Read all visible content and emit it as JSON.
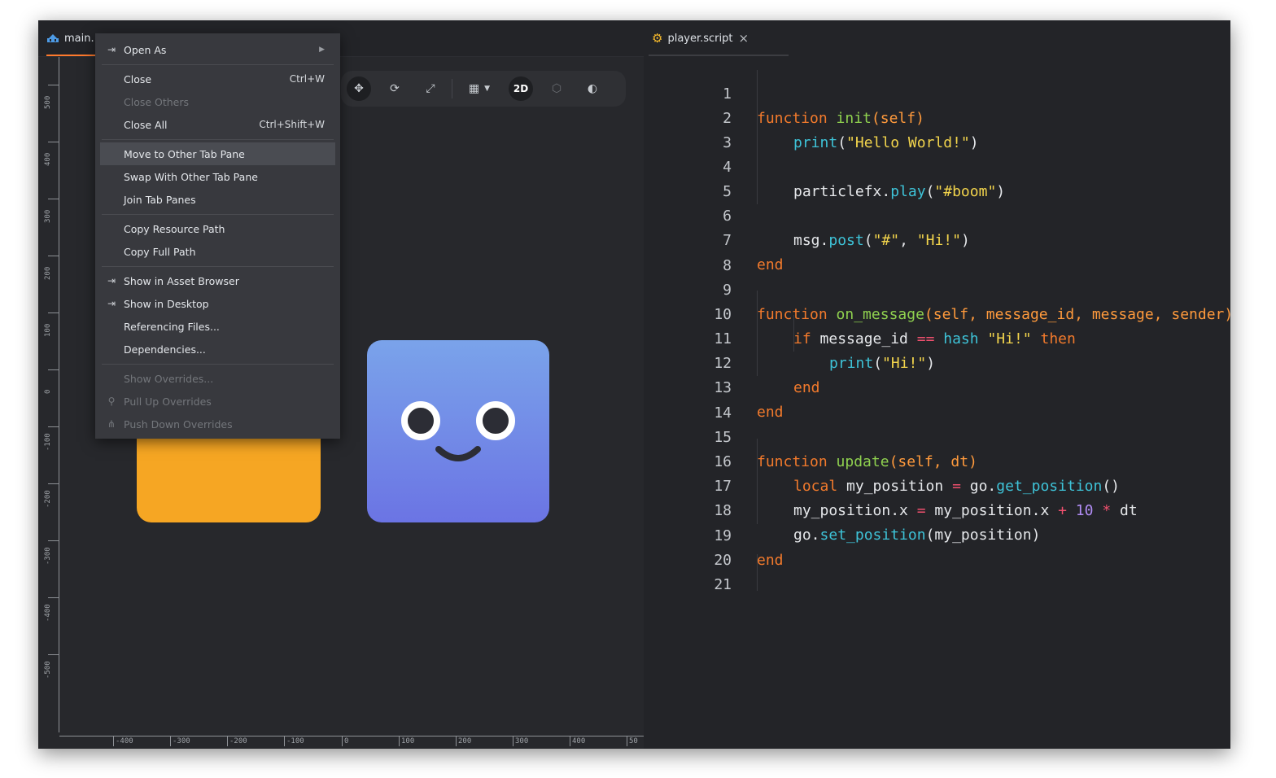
{
  "left_tab": {
    "label": "main.",
    "icon": "collection-icon"
  },
  "right_tab": {
    "label": "player.script",
    "icon": "gear-icon",
    "close": "×"
  },
  "context_menu": {
    "open_as": "Open As",
    "close": "Close",
    "close_shortcut": "Ctrl+W",
    "close_others": "Close Others",
    "close_all": "Close All",
    "close_all_shortcut": "Ctrl+Shift+W",
    "move_to_other": "Move to Other Tab Pane",
    "swap_with_other": "Swap With Other Tab Pane",
    "join_tab_panes": "Join Tab Panes",
    "copy_resource_path": "Copy Resource Path",
    "copy_full_path": "Copy Full Path",
    "show_in_asset_browser": "Show in Asset Browser",
    "show_in_desktop": "Show in Desktop",
    "referencing_files": "Referencing Files...",
    "dependencies": "Dependencies...",
    "show_overrides": "Show Overrides...",
    "pull_up_overrides": "Pull Up Overrides",
    "push_down_overrides": "Push Down Overrides"
  },
  "toolbar": {
    "mode_2d": "2D"
  },
  "ruler_y": [
    "500",
    "400",
    "300",
    "200",
    "100",
    "0",
    "-100",
    "-200",
    "-300",
    "-400",
    "-500"
  ],
  "ruler_x": [
    "-400",
    "-300",
    "-200",
    "-100",
    "0",
    "100",
    "200",
    "300",
    "400",
    "50"
  ],
  "line_numbers": [
    "1",
    "2",
    "3",
    "4",
    "5",
    "6",
    "7",
    "8",
    "9",
    "10",
    "11",
    "12",
    "13",
    "14",
    "15",
    "16",
    "17",
    "18",
    "19",
    "20",
    "21"
  ],
  "code": {
    "l1_kw": "function",
    "l1_fn": "init",
    "l1_par": "(self)",
    "l2_call": "print",
    "l2_open": "(",
    "l2_str": "\"Hello World!\"",
    "l2_close": ")",
    "l4_obj": "particlefx.",
    "l4_method": "play",
    "l4_open": "(",
    "l4_str": "\"#boom\"",
    "l4_close": ")",
    "l6_obj": "msg.",
    "l6_method": "post",
    "l6_open": "(",
    "l6_str1": "\"#\"",
    "l6_comma": ", ",
    "l6_str2": "\"Hi!\"",
    "l6_close": ")",
    "l7_kw": "end",
    "l9_kw": "function",
    "l9_fn": "on_message",
    "l9_par": "(self, message_id, message, sender)",
    "l10_kw": "if",
    "l10_var": " message_id ",
    "l10_op": "==",
    "l10_hash": " hash ",
    "l10_str": "\"Hi!\"",
    "l10_then": " then",
    "l11_call": "print",
    "l11_open": "(",
    "l11_str": "\"Hi!\"",
    "l11_close": ")",
    "l12_kw": "end",
    "l13_kw": "end",
    "l15_kw": "function",
    "l15_fn": "update",
    "l15_par": "(self, dt)",
    "l16_kw": "local",
    "l16_var": " my_position ",
    "l16_op": "=",
    "l16_obj": " go.",
    "l16_method": "get_position",
    "l16_par": "()",
    "l17_var": "my_position.x ",
    "l17_op": "=",
    "l17_var2": " my_position.x ",
    "l17_plus": "+",
    "l17_num": " 10 ",
    "l17_mul": "*",
    "l17_dt": " dt",
    "l18_obj": "go.",
    "l18_method": "set_position",
    "l18_par": "(my_position)",
    "l19_kw": "end"
  }
}
